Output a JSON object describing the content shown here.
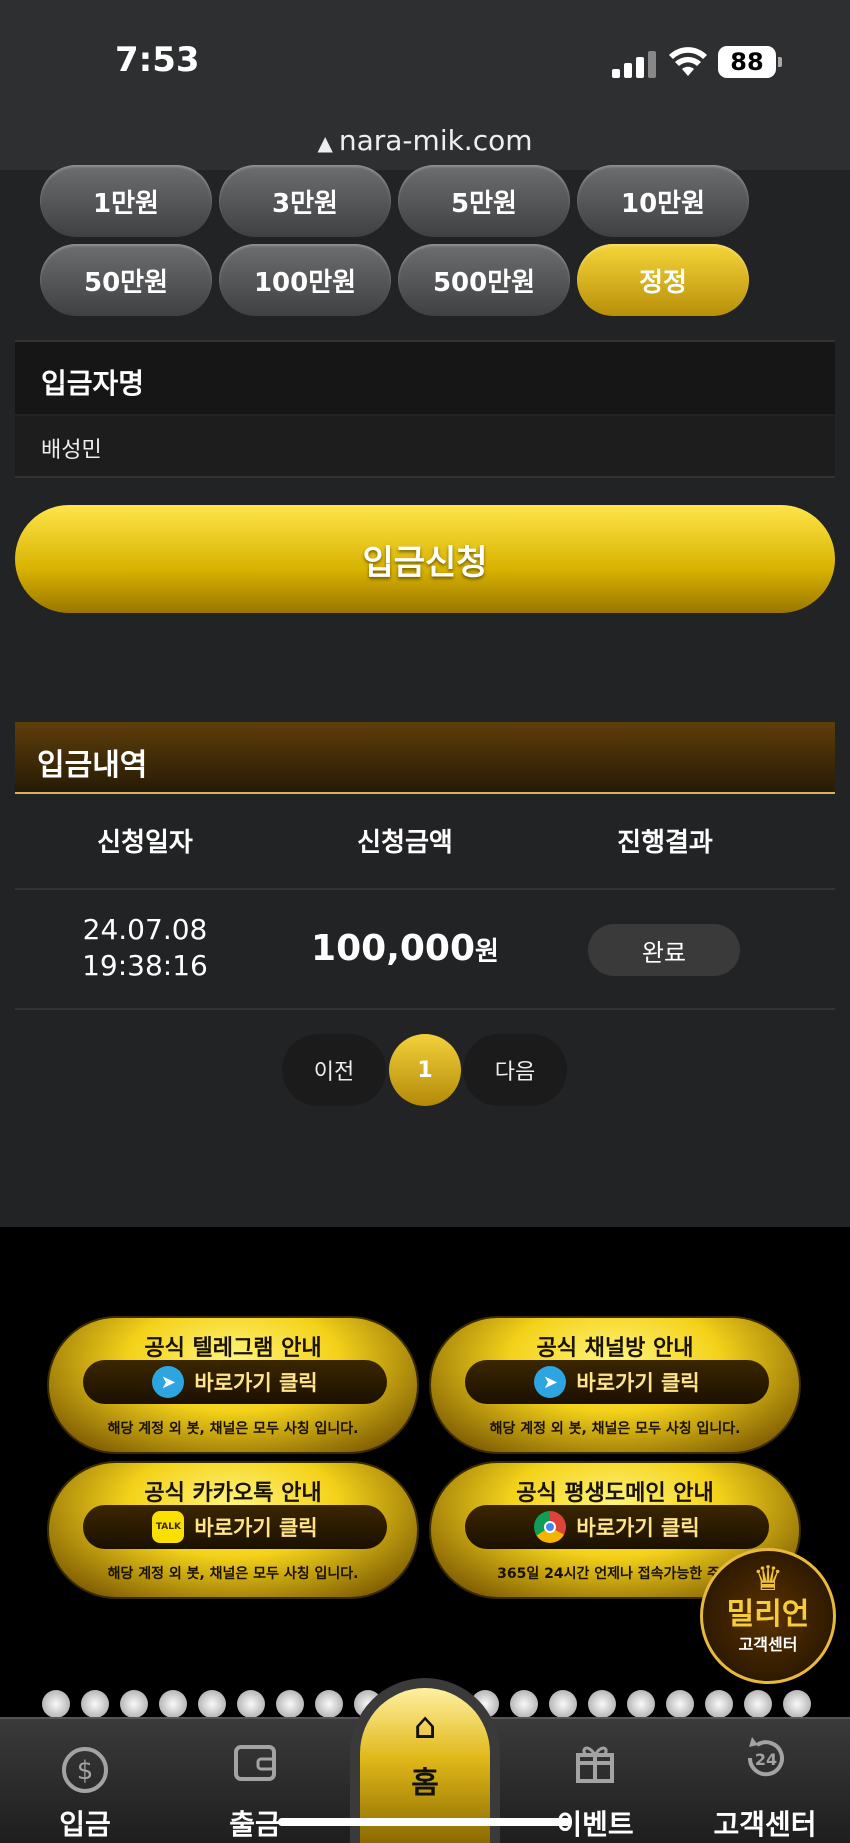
{
  "status_bar": {
    "time": "7:53",
    "battery": "88"
  },
  "browser": {
    "url": "nara-mik.com"
  },
  "amount_buttons": {
    "row1": [
      "1만원",
      "3만원",
      "5만원",
      "10만원"
    ],
    "row2": [
      "50만원",
      "100만원",
      "500만원",
      "정정"
    ]
  },
  "depositor": {
    "label": "입금자명",
    "value": "배성민"
  },
  "submit_label": "입금신청",
  "history": {
    "title": "입금내역",
    "columns": [
      "신청일자",
      "신청금액",
      "진행결과"
    ],
    "rows": [
      {
        "date": "24.07.08",
        "time": "19:38:16",
        "amount": "100,000",
        "unit": "원",
        "status": "완료"
      }
    ],
    "pager": {
      "prev": "이전",
      "current": "1",
      "next": "다음"
    }
  },
  "banners": [
    {
      "title": "공식 텔레그램 안내",
      "button": "바로가기 클릭",
      "note": "해당 계정 외 봇, 채널은 모두 사칭 입니다.",
      "icon": "telegram-icon",
      "icon_color": "#2ca5e0"
    },
    {
      "title": "공식 채널방 안내",
      "button": "바로가기 클릭",
      "note": "해당 계정 외 봇, 채널은 모두 사칭 입니다.",
      "icon": "telegram-icon",
      "icon_color": "#2ca5e0"
    },
    {
      "title": "공식 카카오톡 안내",
      "button": "바로가기 클릭",
      "note": "해당 계정 외 봇, 채널은 모두 사칭 입니다.",
      "icon": "kakaotalk-icon",
      "icon_color": "#f9e000",
      "icon_text": "TALK"
    },
    {
      "title": "공식 평생도메인 안내",
      "button": "바로가기 클릭",
      "note": "365일 24시간 언제나 접속가능한 주소",
      "icon": "chrome-icon",
      "icon_color": "#db4437"
    }
  ],
  "support_badge": {
    "title": "밀리언",
    "subtitle": "고객센터"
  },
  "bottom_nav": {
    "items": [
      {
        "label": "입금",
        "icon": "dollar-coin-icon"
      },
      {
        "label": "출금",
        "icon": "wallet-icon"
      },
      {
        "label": "홈",
        "icon": "home-icon"
      },
      {
        "label": "이벤트",
        "icon": "gift-icon"
      },
      {
        "label": "고객센터",
        "icon": "24h-support-icon"
      }
    ]
  },
  "colors": {
    "accent_gold": "#e7c21e",
    "background": "#222325",
    "header_brown": "#5e3e0a"
  }
}
